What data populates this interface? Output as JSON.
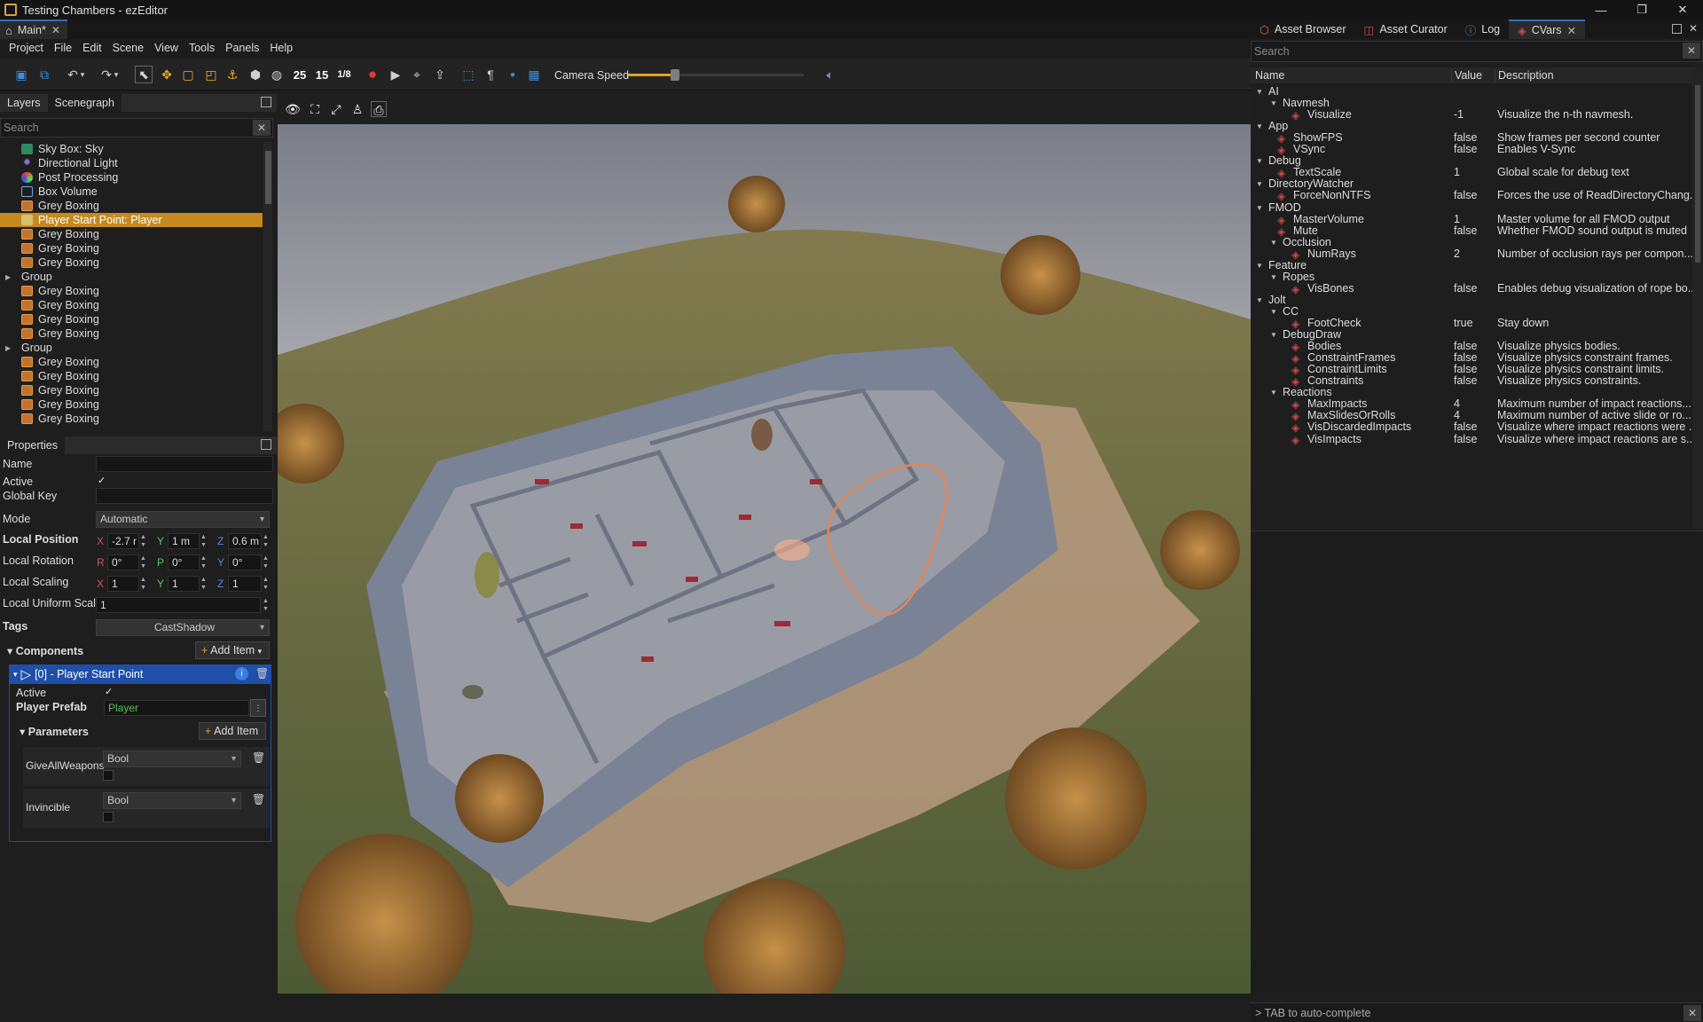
{
  "window": {
    "title": "Testing Chambers - ezEditor",
    "minimize": "—",
    "restore": "❐",
    "close": "✕"
  },
  "doc_tab": {
    "label": "Main*",
    "close": "✕"
  },
  "menu": [
    "Project",
    "File",
    "Edit",
    "Scene",
    "View",
    "Tools",
    "Panels",
    "Help"
  ],
  "toolbar": {
    "num_a": "25",
    "num_b": "15",
    "fraction": "1/8",
    "camera_speed_label": "Camera Speed",
    "camera_speed_fraction": 0.24
  },
  "layers": {
    "tabs": [
      "Layers",
      "Scenegraph"
    ],
    "search_placeholder": "Search",
    "items": [
      {
        "label": "Sky Box: Sky",
        "icon": "sky"
      },
      {
        "label": "Directional Light",
        "icon": "light"
      },
      {
        "label": "Post Processing",
        "icon": "pp"
      },
      {
        "label": "Box Volume",
        "icon": "vol"
      },
      {
        "label": "Grey Boxing",
        "icon": "box"
      },
      {
        "label": "Player Start Point: Player",
        "icon": "player",
        "selected": true
      },
      {
        "label": "Grey Boxing",
        "icon": "box"
      },
      {
        "label": "Grey Boxing",
        "icon": "box"
      },
      {
        "label": "Grey Boxing",
        "icon": "box"
      },
      {
        "label": "Group",
        "icon": "group"
      },
      {
        "label": "Grey Boxing",
        "icon": "box"
      },
      {
        "label": "Grey Boxing",
        "icon": "box"
      },
      {
        "label": "Grey Boxing",
        "icon": "box"
      },
      {
        "label": "Grey Boxing",
        "icon": "box"
      },
      {
        "label": "Group",
        "icon": "group"
      },
      {
        "label": "Grey Boxing",
        "icon": "box"
      },
      {
        "label": "Grey Boxing",
        "icon": "box"
      },
      {
        "label": "Grey Boxing",
        "icon": "box"
      },
      {
        "label": "Grey Boxing",
        "icon": "box"
      },
      {
        "label": "Grey Boxing",
        "icon": "box"
      }
    ]
  },
  "properties": {
    "title": "Properties",
    "name_label": "Name",
    "active_label": "Active",
    "global_key_label": "Global Key",
    "mode_label": "Mode",
    "mode_value": "Automatic",
    "local_position_label": "Local Position",
    "pos": {
      "x": "-2.7 r",
      "y": "1 m",
      "z": "0.6 m"
    },
    "local_rotation_label": "Local Rotation",
    "rot": {
      "r": "0°",
      "p": "0°",
      "y": "0°"
    },
    "local_scaling_label": "Local Scaling",
    "scale": {
      "x": "1",
      "y": "1",
      "z": "1"
    },
    "local_uniform_label": "Local Uniform Scal",
    "uniform_value": "1",
    "tags_label": "Tags",
    "tags_value": "CastShadow",
    "components_label": "Components",
    "add_item": "Add Item",
    "component_title": "[0] - Player Start Point",
    "comp_active_label": "Active",
    "player_prefab_label": "Player Prefab",
    "player_prefab_value": "Player",
    "parameters_label": "Parameters",
    "params": [
      {
        "name": "GiveAllWeapons",
        "type": "Bool"
      },
      {
        "name": "Invincible",
        "type": "Bool"
      }
    ],
    "axis": {
      "x": "X",
      "y": "Y",
      "z": "Z",
      "r": "R",
      "p": "P"
    }
  },
  "right_tabs": [
    {
      "label": "Asset Browser"
    },
    {
      "label": "Asset Curator"
    },
    {
      "label": "Log"
    },
    {
      "label": "CVars",
      "active": true
    }
  ],
  "cvars": {
    "search_placeholder": "Search",
    "columns": {
      "name": "Name",
      "value": "Value",
      "description": "Description"
    },
    "rows": [
      {
        "depth": 0,
        "group": true,
        "name": "AI"
      },
      {
        "depth": 1,
        "group": true,
        "name": "Navmesh"
      },
      {
        "depth": 2,
        "name": "Visualize",
        "value": "-1",
        "desc": "Visualize the n-th navmesh."
      },
      {
        "depth": 0,
        "group": true,
        "name": "App"
      },
      {
        "depth": 1,
        "name": "ShowFPS",
        "value": "false",
        "desc": "Show frames per second counter"
      },
      {
        "depth": 1,
        "name": "VSync",
        "value": "false",
        "desc": "Enables V-Sync"
      },
      {
        "depth": 0,
        "group": true,
        "name": "Debug"
      },
      {
        "depth": 1,
        "name": "TextScale",
        "value": "1",
        "desc": "Global scale for debug text"
      },
      {
        "depth": 0,
        "group": true,
        "name": "DirectoryWatcher"
      },
      {
        "depth": 1,
        "name": "ForceNonNTFS",
        "value": "false",
        "desc": "Forces the use of ReadDirectoryChang..."
      },
      {
        "depth": 0,
        "group": true,
        "name": "FMOD"
      },
      {
        "depth": 1,
        "name": "MasterVolume",
        "value": "1",
        "desc": "Master volume for all FMOD output"
      },
      {
        "depth": 1,
        "name": "Mute",
        "value": "false",
        "desc": "Whether FMOD sound output is muted"
      },
      {
        "depth": 1,
        "group": true,
        "name": "Occlusion"
      },
      {
        "depth": 2,
        "name": "NumRays",
        "value": "2",
        "desc": "Number of occlusion rays per compon..."
      },
      {
        "depth": 0,
        "group": true,
        "name": "Feature"
      },
      {
        "depth": 1,
        "group": true,
        "name": "Ropes"
      },
      {
        "depth": 2,
        "name": "VisBones",
        "value": "false",
        "desc": "Enables debug visualization of rope bo..."
      },
      {
        "depth": 0,
        "group": true,
        "name": "Jolt"
      },
      {
        "depth": 1,
        "group": true,
        "name": "CC"
      },
      {
        "depth": 2,
        "name": "FootCheck",
        "value": "true",
        "desc": "Stay down"
      },
      {
        "depth": 1,
        "group": true,
        "name": "DebugDraw"
      },
      {
        "depth": 2,
        "name": "Bodies",
        "value": "false",
        "desc": "Visualize physics bodies."
      },
      {
        "depth": 2,
        "name": "ConstraintFrames",
        "value": "false",
        "desc": "Visualize physics constraint frames."
      },
      {
        "depth": 2,
        "name": "ConstraintLimits",
        "value": "false",
        "desc": "Visualize physics constraint limits."
      },
      {
        "depth": 2,
        "name": "Constraints",
        "value": "false",
        "desc": "Visualize physics constraints."
      },
      {
        "depth": 1,
        "group": true,
        "name": "Reactions"
      },
      {
        "depth": 2,
        "name": "MaxImpacts",
        "value": "4",
        "desc": "Maximum number of impact reactions..."
      },
      {
        "depth": 2,
        "name": "MaxSlidesOrRolls",
        "value": "4",
        "desc": "Maximum number of active slide or ro..."
      },
      {
        "depth": 2,
        "name": "VisDiscardedImpacts",
        "value": "false",
        "desc": "Visualize where impact reactions were ..."
      },
      {
        "depth": 2,
        "name": "VisImpacts",
        "value": "false",
        "desc": "Visualize where impact reactions are s..."
      }
    ]
  },
  "console": {
    "hint": "> TAB to auto-complete"
  }
}
